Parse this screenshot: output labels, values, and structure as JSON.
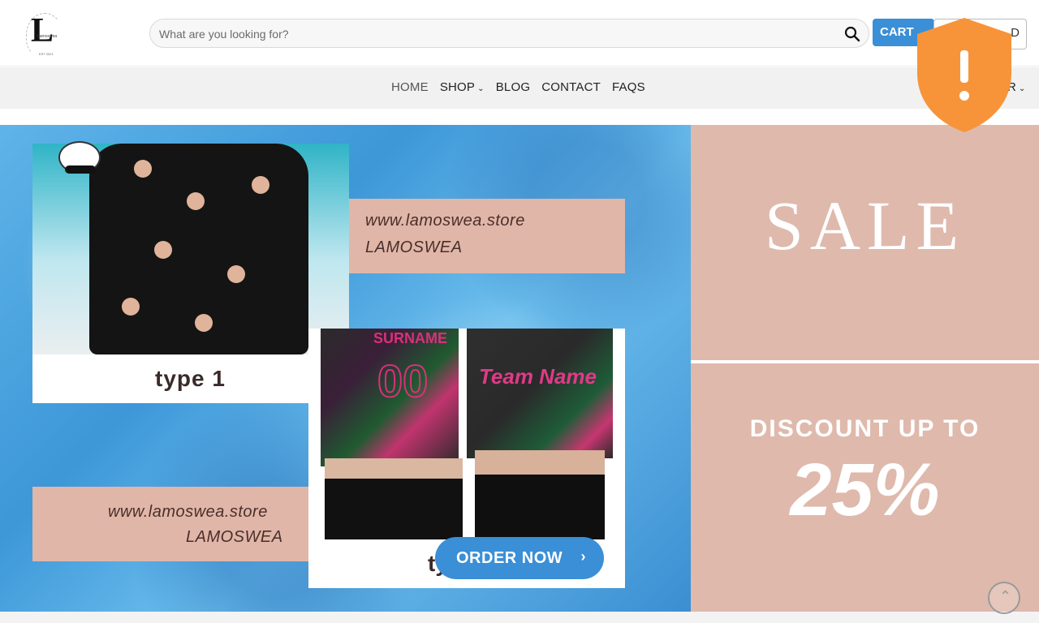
{
  "header": {
    "logo_letter": "L",
    "logo_brand": "Lamoswea",
    "logo_est": "EST 2021",
    "search": {
      "placeholder": "What are you looking for?",
      "value": ""
    },
    "cart_label": "CART",
    "account_label": "D"
  },
  "nav": {
    "items": [
      {
        "label": "HOME"
      },
      {
        "label": "SHOP"
      },
      {
        "label": "BLOG"
      },
      {
        "label": "CONTACT"
      },
      {
        "label": "FAQS"
      }
    ],
    "right_label": "R"
  },
  "banner": {
    "url_text": "www.lamoswea.store",
    "brand_text": "LAMOSWEA",
    "type1_label": "type 1",
    "type2_label": "ty",
    "jersey_number": "00",
    "jersey_surname": "SURNAME",
    "jersey_team": "Team Name",
    "order_button": "ORDER NOW",
    "order_arrow": "›"
  },
  "promo": {
    "sale": "SALE",
    "discount": "DISCOUNT UP TO",
    "percent": "25%"
  },
  "colors": {
    "accent_blue": "#3a8fd6",
    "promo_pink": "#dfb9ac",
    "shield_orange": "#f79439"
  },
  "icons": {
    "search": "search-icon",
    "shield": "warning-shield-icon",
    "back_to_top": "chevron-up-icon"
  }
}
